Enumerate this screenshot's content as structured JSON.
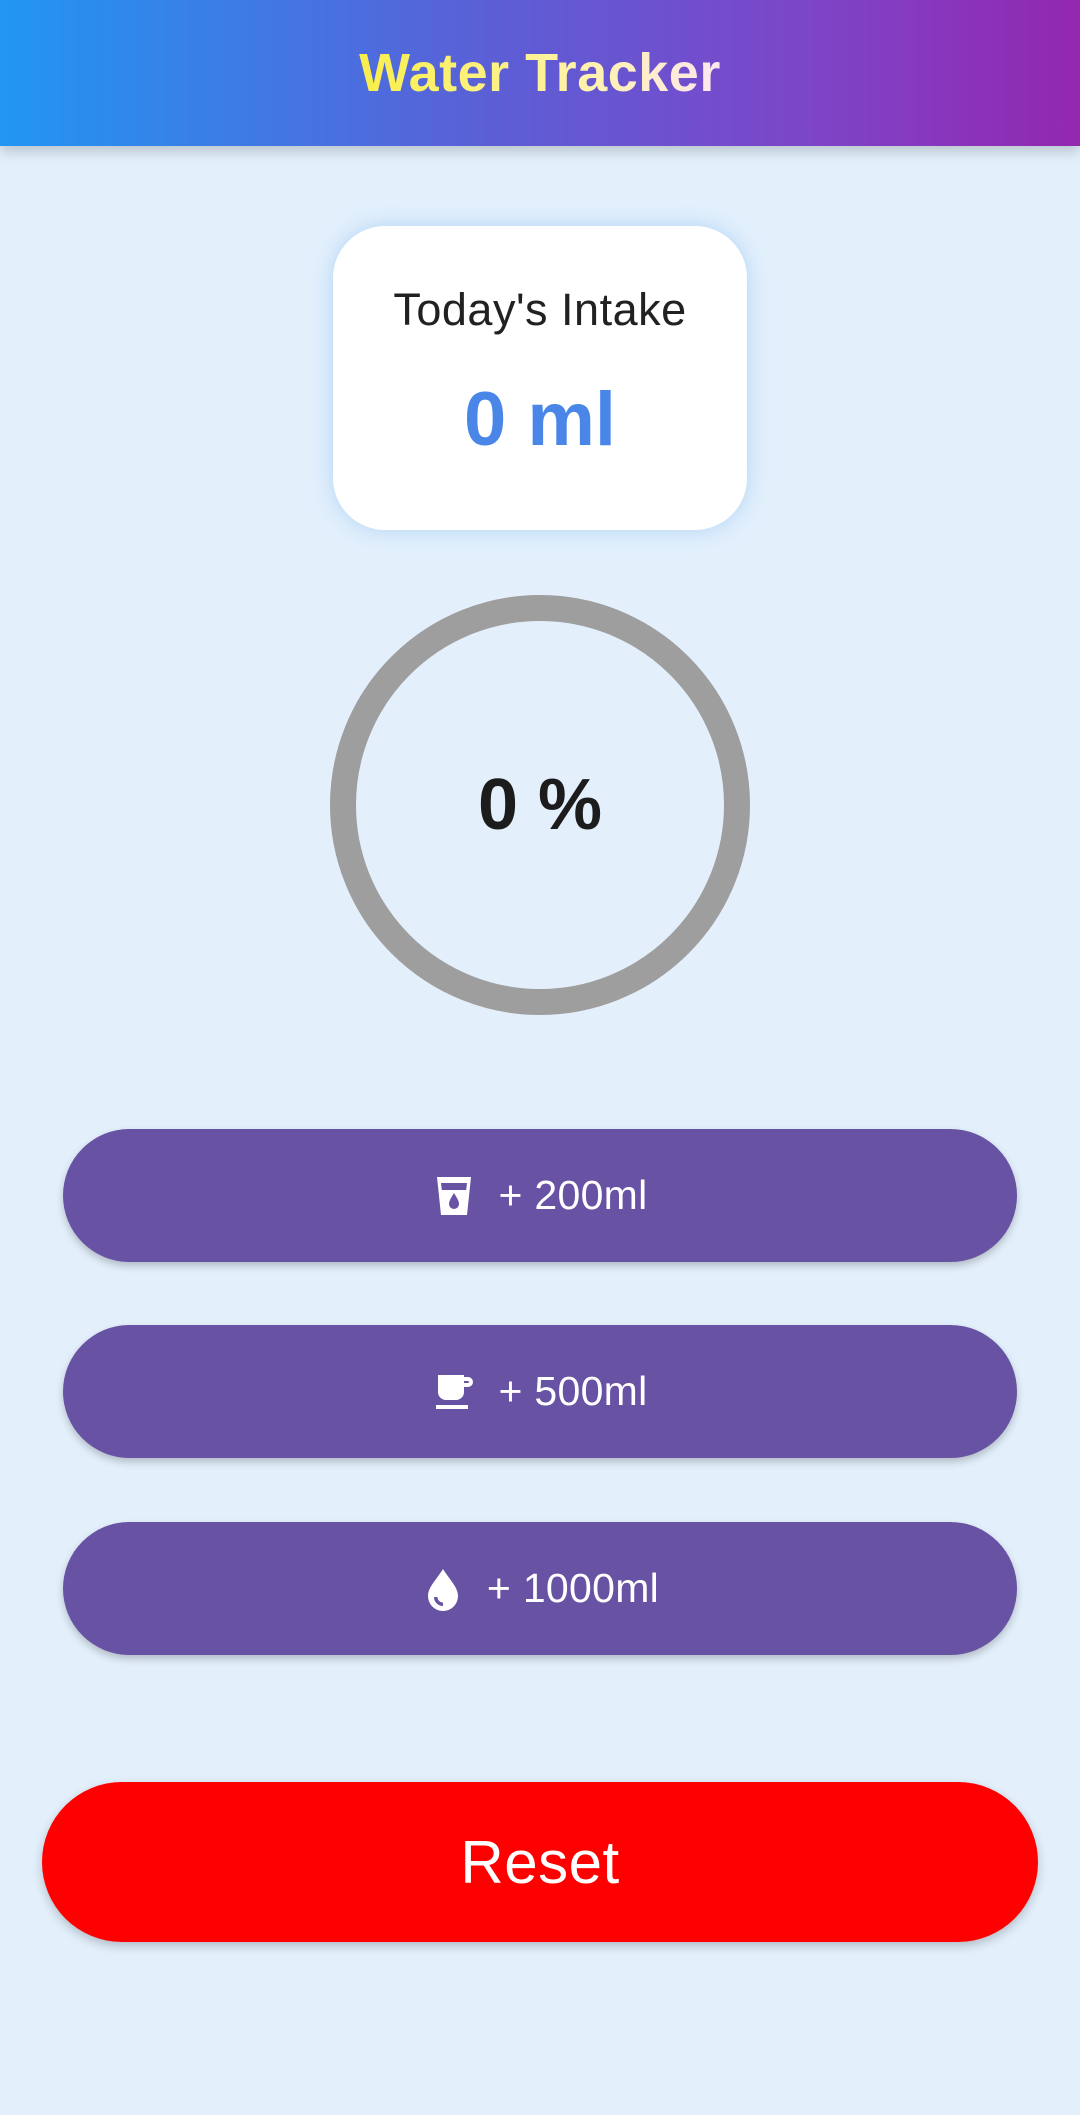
{
  "header": {
    "title": "Water Tracker"
  },
  "intake": {
    "label": "Today's Intake",
    "value": "0 ml"
  },
  "progress": {
    "text": "0 %",
    "fraction": 0,
    "ring_color": "#9e9e9e"
  },
  "buttons": [
    {
      "icon": "glass-water-icon",
      "label": "+ 200ml"
    },
    {
      "icon": "coffee-cup-icon",
      "label": "+ 500ml"
    },
    {
      "icon": "water-drop-icon",
      "label": "+ 1000ml"
    }
  ],
  "reset": {
    "label": "Reset"
  },
  "colors": {
    "background": "#e3f0fc",
    "button": "#6852a4",
    "reset": "#ff0000",
    "intake_value": "#4a86e8",
    "title": "#f9ee4a"
  }
}
